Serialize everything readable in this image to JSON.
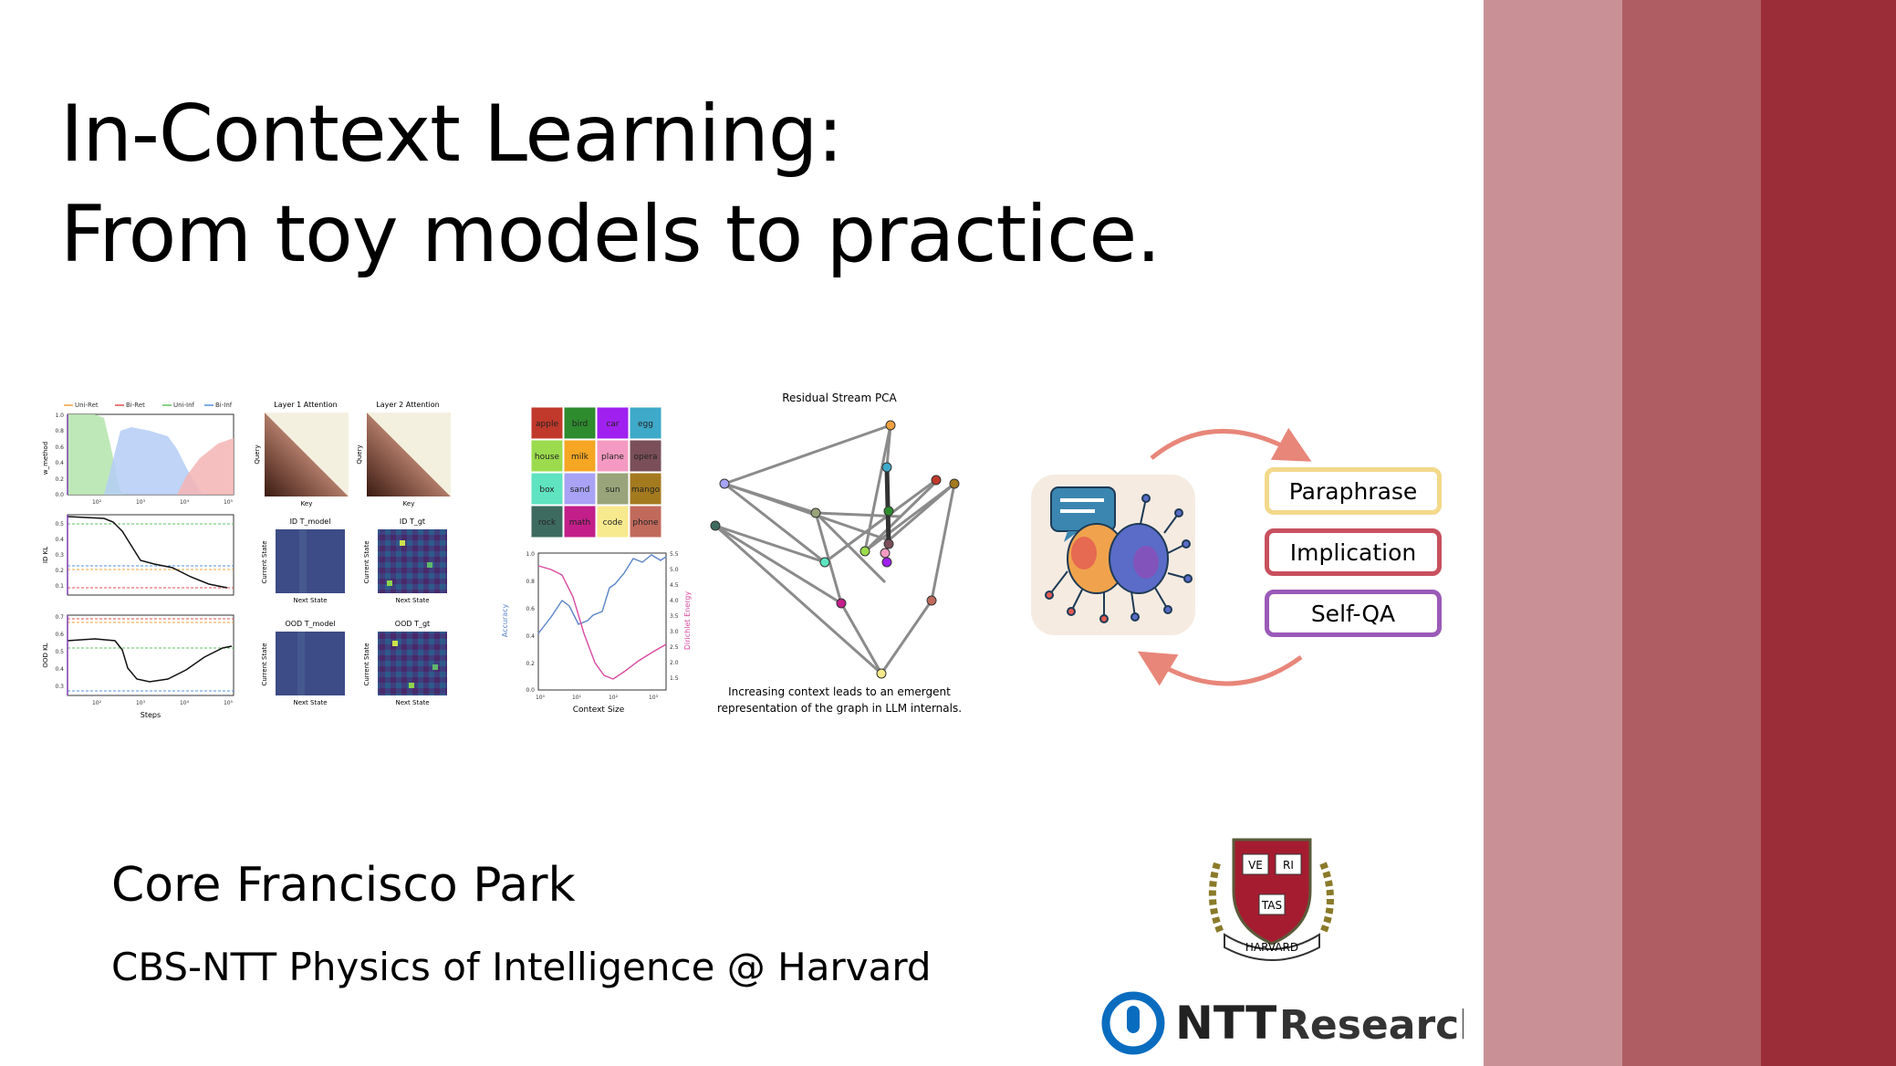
{
  "slide": {
    "title_line1": "In-Context Learning:",
    "title_line2": "From toy models to practice.",
    "author": "Core Francisco Park",
    "affiliation": "CBS-NTT Physics of Intelligence @ Harvard"
  },
  "colors": {
    "stripe1": "#c99196",
    "stripe2": "#b05c63",
    "stripe3": "#9a2d37",
    "harvard_crimson": "#a51c30",
    "ntt_blue": "#0a6cbf"
  },
  "fig_left": {
    "legend": [
      "Uni-Ret",
      "Bi-Ret",
      "Uni-Inf",
      "Bi-Inf"
    ],
    "top_ylabel": "w_method",
    "top_yticks": [
      "1.0",
      "0.8",
      "0.6",
      "0.4",
      "0.2",
      "0.0"
    ],
    "id_ylabel": "ID KL",
    "id_yticks": [
      "0.5",
      "0.4",
      "0.3",
      "0.2",
      "0.1"
    ],
    "ood_ylabel": "OOD KL",
    "ood_yticks": [
      "0.7",
      "0.6",
      "0.5",
      "0.4",
      "0.3"
    ],
    "xticks": [
      "10²",
      "10³",
      "10⁴",
      "10⁵"
    ],
    "xlabel": "Steps"
  },
  "fig_attention": {
    "layer1_title": "Layer 1 Attention",
    "layer2_title": "Layer 2 Attention",
    "query_label": "Query",
    "key_label": "Key",
    "id_model": "ID T_model",
    "id_gt": "ID T_gt",
    "ood_model": "OOD T_model",
    "ood_gt": "OOD T_gt",
    "current_state": "Current State",
    "next_state": "Next State"
  },
  "fig_words": {
    "grid": [
      {
        "w": "apple",
        "c": "#c0392b"
      },
      {
        "w": "bird",
        "c": "#2e8b2e"
      },
      {
        "w": "car",
        "c": "#a020f0"
      },
      {
        "w": "egg",
        "c": "#3fa9c9"
      },
      {
        "w": "house",
        "c": "#9bdb4d"
      },
      {
        "w": "milk",
        "c": "#f5a623"
      },
      {
        "w": "plane",
        "c": "#f49ac2"
      },
      {
        "w": "opera",
        "c": "#7a4f5a"
      },
      {
        "w": "box",
        "c": "#5fe3c0"
      },
      {
        "w": "sand",
        "c": "#a8a3f5"
      },
      {
        "w": "sun",
        "c": "#9aa47a"
      },
      {
        "w": "mango",
        "c": "#a47a1f"
      },
      {
        "w": "rock",
        "c": "#3e6b5f"
      },
      {
        "w": "math",
        "c": "#c21f8a"
      },
      {
        "w": "code",
        "c": "#f7e98e"
      },
      {
        "w": "phone",
        "c": "#c06a5c"
      }
    ],
    "ylabel_left": "Accuracy",
    "ylabel_right": "Dirichlet Energy",
    "left_ticks": [
      "1.0",
      "0.8",
      "0.6",
      "0.4",
      "0.2",
      "0.0"
    ],
    "right_ticks": [
      "5.5",
      "5.0",
      "4.5",
      "4.0",
      "3.5",
      "3.0",
      "2.5",
      "2.0",
      "1.5"
    ],
    "xticks": [
      "10⁰",
      "10¹",
      "10²",
      "10³"
    ],
    "xlabel": "Context Size"
  },
  "fig_pca": {
    "title": "Residual Stream PCA",
    "caption_line1": "Increasing context leads to an emergent",
    "caption_line2": "representation of the graph in LLM internals."
  },
  "fig_cycle": {
    "tags": [
      {
        "label": "Paraphrase",
        "border": "#f2d98a"
      },
      {
        "label": "Implication",
        "border": "#c8505e"
      },
      {
        "label": "Self-QA",
        "border": "#9a5ab8"
      }
    ]
  },
  "logos": {
    "harvard_top": [
      "VE",
      "RI"
    ],
    "harvard_bottom": "TAS",
    "harvard_banner": "HARVARD",
    "ntt_name": "NTT",
    "ntt_suffix": "Research"
  }
}
